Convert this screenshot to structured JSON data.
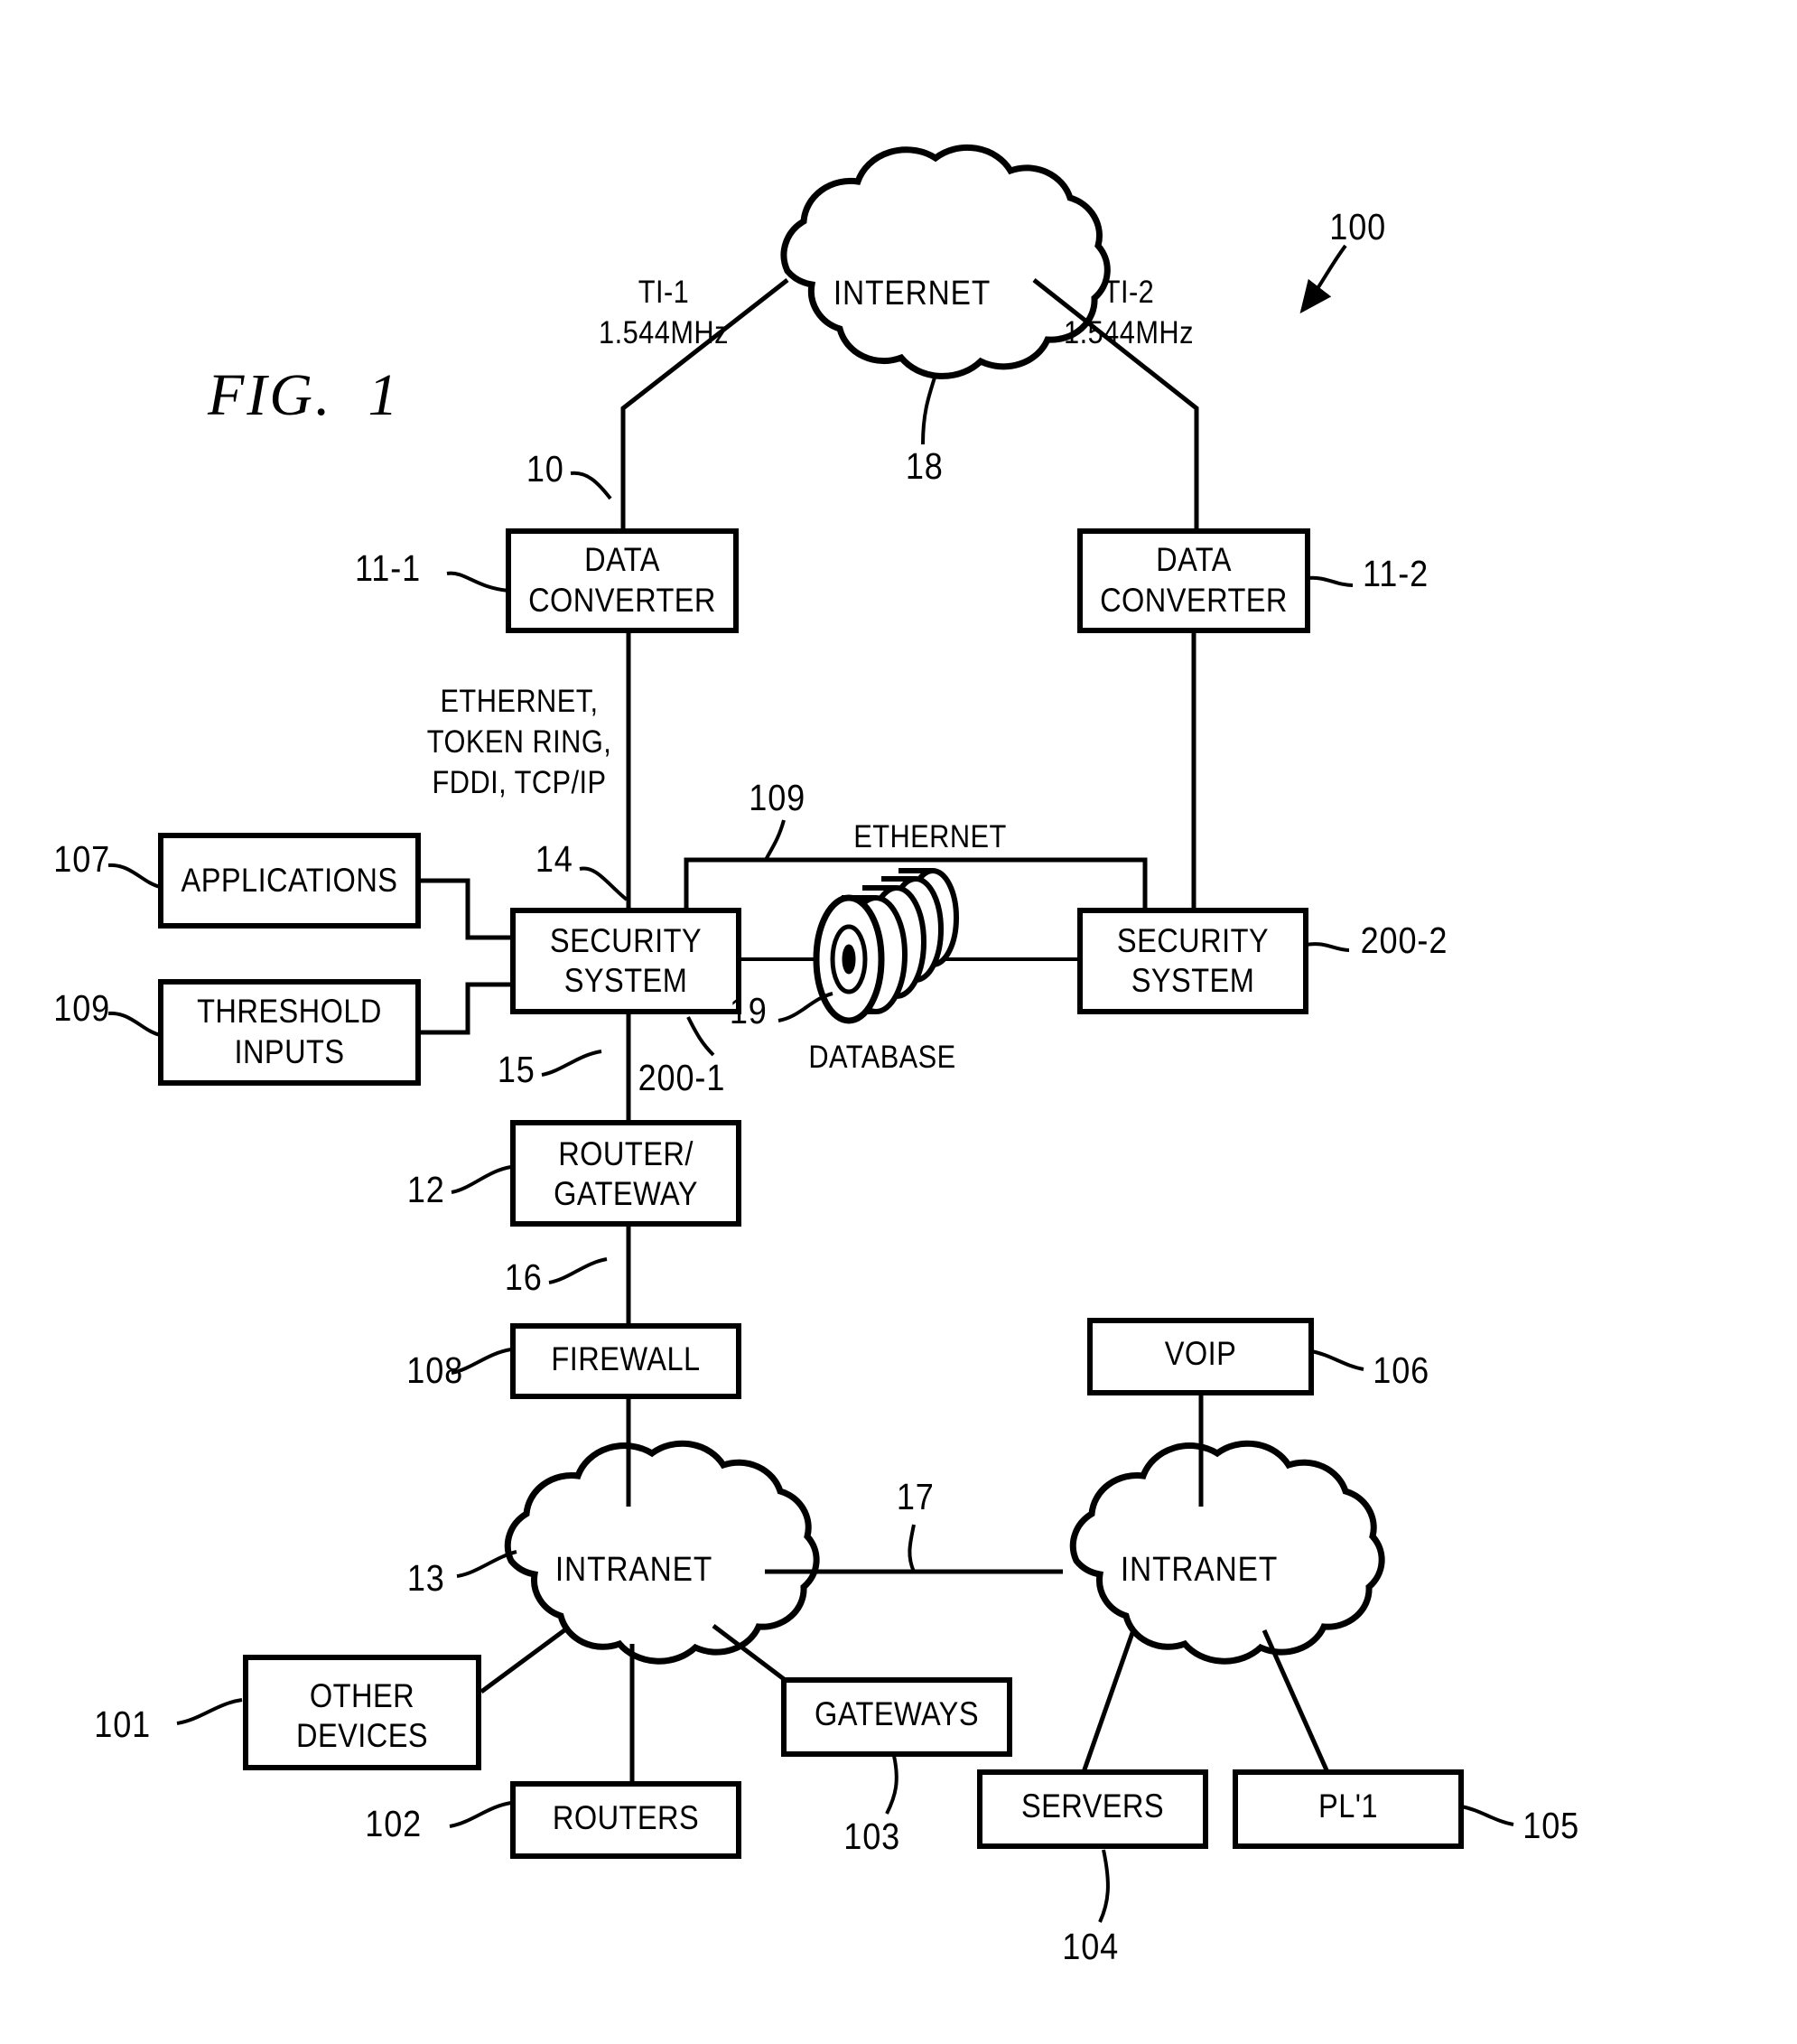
{
  "figure": {
    "title": "FIG.  1",
    "system_ref": "100"
  },
  "clouds": {
    "internet": {
      "label": "INTERNET",
      "ref": "18"
    },
    "intranet_left": {
      "label": "INTRANET",
      "ref": "13"
    },
    "intranet_right": {
      "label": "INTRANET",
      "ref": ""
    }
  },
  "links": {
    "t1_left": {
      "name": "TI-1",
      "rate": "1.544MHz"
    },
    "t1_right": {
      "name": "TI-2",
      "rate": "1.544MHz"
    },
    "trunk_left_ref": "10",
    "protocols": "ETHERNET,\nTOKEN RING,\nFDDI, TCP/IP",
    "ethernet_bus_label": "ETHERNET",
    "ethernet_bus_ref": "109",
    "security_in_ref": "14",
    "security_out_ref": "15",
    "router_out_ref": "16",
    "intranet_interconnect_ref": "17"
  },
  "boxes": {
    "data_converter_left": {
      "line1": "DATA",
      "line2": "CONVERTER",
      "ref": "11-1"
    },
    "data_converter_right": {
      "line1": "DATA",
      "line2": "CONVERTER",
      "ref": "11-2"
    },
    "security_system_left": {
      "line1": "SECURITY",
      "line2": "SYSTEM",
      "ref": "200-1"
    },
    "security_system_right": {
      "line1": "SECURITY",
      "line2": "SYSTEM",
      "ref": "200-2"
    },
    "applications": {
      "line1": "APPLICATIONS",
      "line2": "",
      "ref": "107"
    },
    "threshold_inputs": {
      "line1": "THRESHOLD",
      "line2": "INPUTS",
      "ref": "109"
    },
    "router_gateway": {
      "line1": "ROUTER/",
      "line2": "GATEWAY",
      "ref": "12"
    },
    "firewall": {
      "line1": "FIREWALL",
      "line2": "",
      "ref": "108"
    },
    "voip": {
      "line1": "VOIP",
      "line2": "",
      "ref": "106"
    },
    "other_devices": {
      "line1": "OTHER",
      "line2": "DEVICES",
      "ref": "101"
    },
    "routers": {
      "line1": "ROUTERS",
      "line2": "",
      "ref": "102"
    },
    "gateways": {
      "line1": "GATEWAYS",
      "line2": "",
      "ref": "103"
    },
    "servers": {
      "line1": "SERVERS",
      "line2": "",
      "ref": "104"
    },
    "pl1": {
      "line1": "PL'1",
      "line2": "",
      "ref": "105"
    }
  },
  "database": {
    "label": "DATABASE",
    "ref": "19"
  },
  "colors": {
    "ink": "#000000",
    "paper": "#ffffff"
  }
}
